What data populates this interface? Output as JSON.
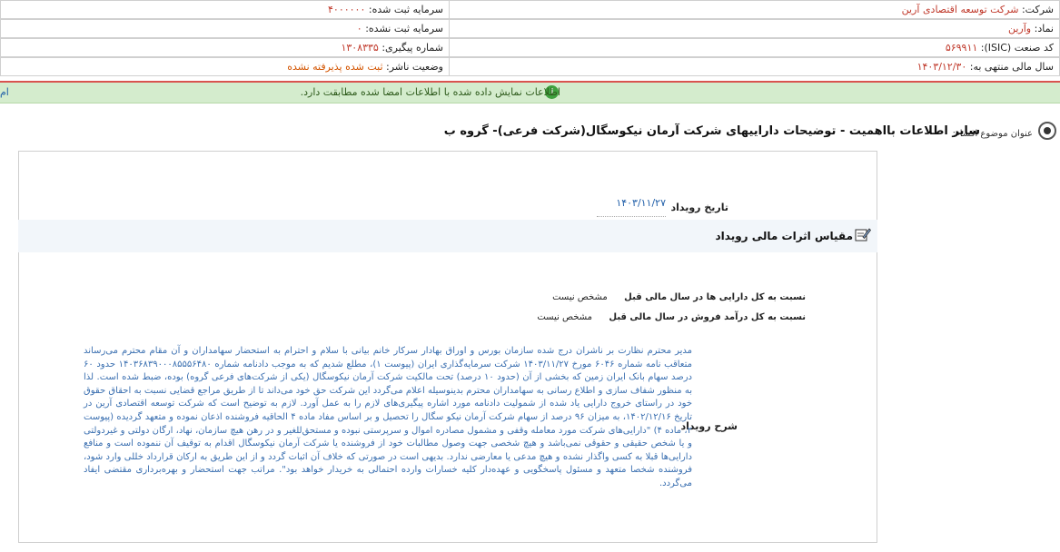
{
  "header": {
    "company_label": "شرکت:",
    "company_value": "شرکت توسعه اقتصادی آرین",
    "symbol_label": "نماد:",
    "symbol_value": "وآرین",
    "isic_label": "کد صنعت (ISIC):",
    "isic_value": "۵۶۹۹۱۱",
    "fiscal_label": "سال مالی منتهی به:",
    "fiscal_value": "۱۴۰۳/۱۲/۳۰",
    "registered_capital_label": "سرمایه ثبت شده:",
    "registered_capital_value": "۴۰۰۰۰۰۰",
    "unregistered_capital_label": "سرمایه ثبت نشده:",
    "unregistered_capital_value": "۰",
    "tracking_label": "شماره پیگیری:",
    "tracking_value": "۱۳۰۸۳۳۵",
    "publisher_status_label": "وضعیت ناشر:",
    "publisher_status_value": "ثبت شده پذیرفته نشده"
  },
  "notice": {
    "text": "اطلاعات نمایش داده شده با اطلاعات امضا شده مطابقت دارد.",
    "edge_text": "ام"
  },
  "subject": {
    "label": "عنوان موضوع افشاء:",
    "title": "سایر اطلاعات بااهمیت - توضیحات داراییهای شرکت آرمان نیکوسگال(شرکت فرعی)- گروه ب"
  },
  "event": {
    "date_label": "تاریخ رویداد",
    "date_value": "۱۴۰۳/۱۱/۲۷",
    "section_title": "مقیاس اثرات مالی رویداد",
    "assets_ratio_label": "نسبت به کل دارایی ها در سال مالی قبل",
    "assets_ratio_value": "مشخص نیست",
    "sales_ratio_label": "نسبت به کل درآمد فروش در سال مالی قبل",
    "sales_ratio_value": "مشخص نیست",
    "description_label": "شرح رویداد",
    "description": "مدیر محترم نظارت بر ناشران درج شده سازمان بورس و اوراق بهادار سرکار خانم بیانی با سلام و احترام به استحضار سهامداران و آن مقام محترم می‌رساند متعاقب نامه شماره ۶۰۴۶ مورخ ۱۴۰۳/۱۱/۲۷ شرکت سرمایه‌گذاری ایران (پیوست ۱)، مطلع شدیم که به موجب دادنامه شماره ۱۴۰۳۶۸۳۹۰۰۰۸۵۵۵۶۴۸۰ حدود ۶۰ درصد سهام بانک ایران زمین که بخشی از آن (حدود ۱۰ درصد) تحت مالکیت شرکت آرمان نیکوسگال (یکی از شرکت‌های فرعی گروه) بوده، ضبط شده است. لذا به منظور شفاف سازی و اطلاع رسانی به سهامداران محترم بدینوسیله اعلام می‌گردد این شرکت حق خود می‌داند تا از طریق مراجع قضایی نسبت به احقاق حقوق خود در راستای خروج دارایی یاد شده از شمولیت دادنامه مورد اشاره پیگیری‌های لازم را به عمل آورد. لازم به توضیح است که شرکت توسعه اقتصادی آرین در تاریخ ۱۴۰۲/۱۲/۱۶، به میزان ۹۶ درصد از سهام شرکت آرمان نیکو سگال را تحصیل و بر اساس مفاد ماده ۴ الحاقیه فروشنده اذعان نموده و متعهد گردیده (پیوست ۲، ماده ۴) \"دارایی‌های شرکت مورد معامله وقفی و مشمول مصادره اموال و سرپرستی نبوده و مستحق‌للغیر و در رهن هیچ سازمان، نهاد، ارگان دولتی و غیردولتی و یا شخص حقیقی و حقوقی نمی‌باشد و هیچ شخصی جهت وصول مطالبات خود از فروشنده یا شرکت آرمان نیکوسگال اقدام به توقیف آن ننموده است و منافع دارایی‌ها قبلا به کسی واگذار نشده و هیچ مدعی یا معارضی ندارد. بدیهی است در صورتی که خلاف آن اثبات گردد و از این طریق به ارکان قرارداد خللی وارد شود، فروشنده شخصا متعهد و مسئول پاسخگویی و عهده‌دار کلیه خسارات وارده احتمالی به خریدار خواهد بود\". مراتب جهت استحضار و بهره‌برداری مقتضی ایفاد می‌گردد."
  },
  "colors": {
    "accent_red": "#d9534f",
    "notice_green": "#d4eccd",
    "link_blue": "#1f5ea8"
  }
}
